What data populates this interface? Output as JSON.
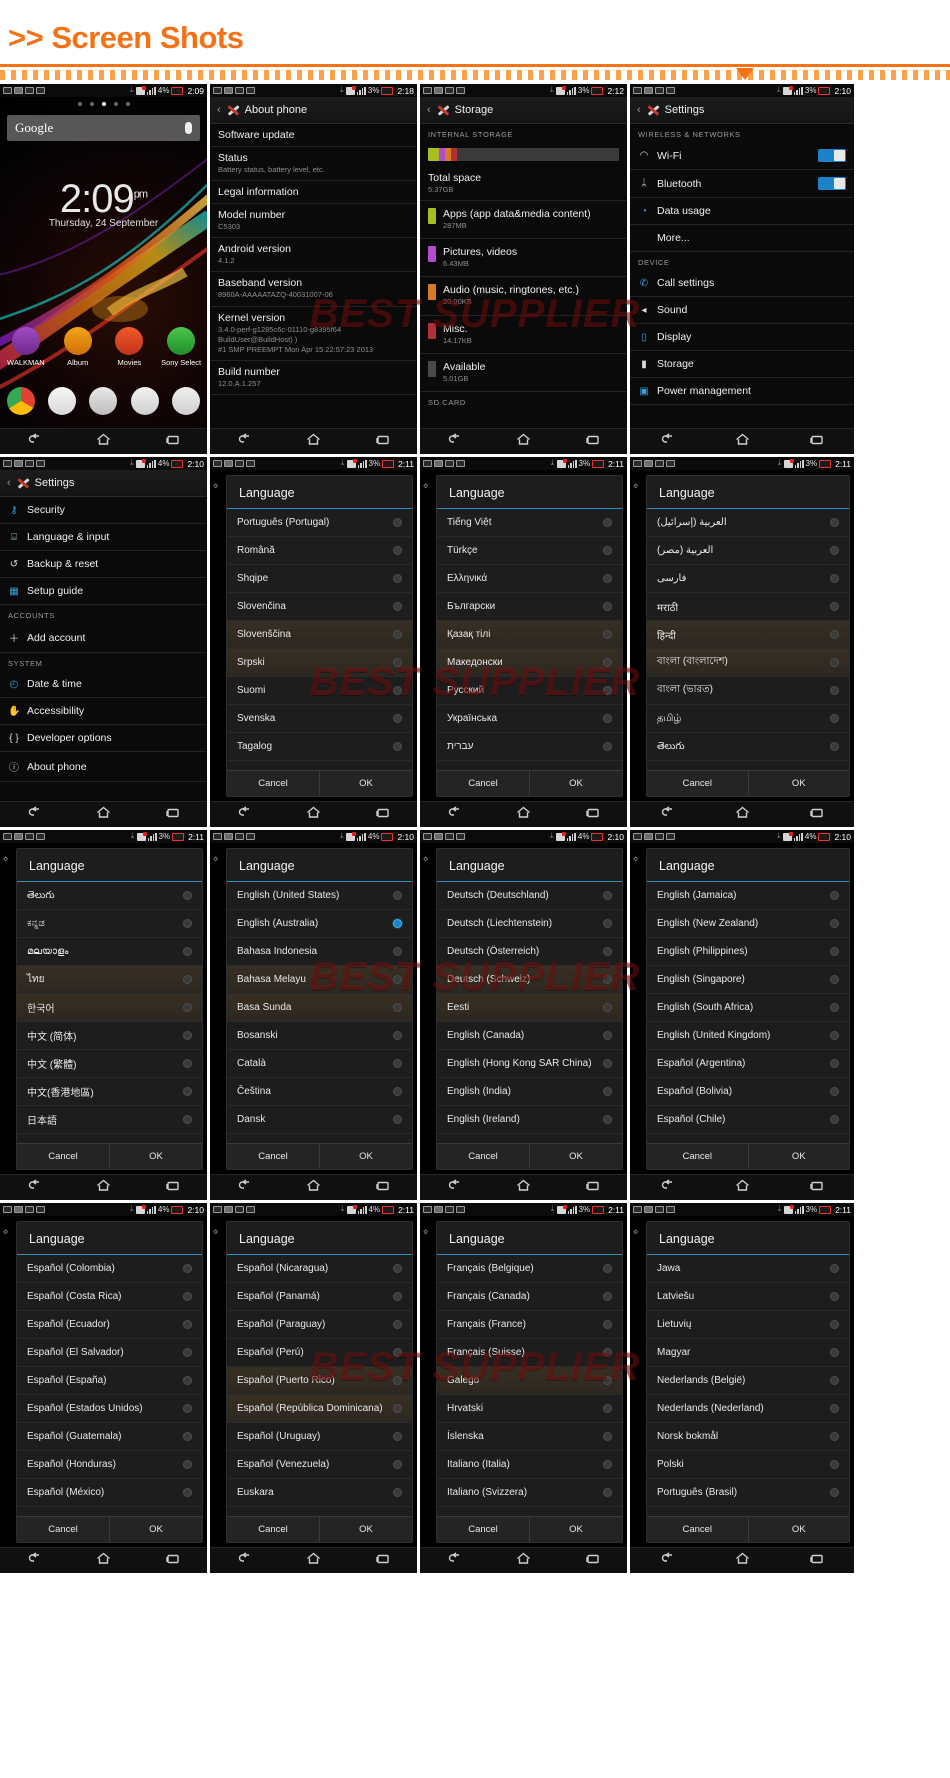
{
  "header": {
    "title": ">> Screen Shots"
  },
  "watermark": {
    "text": "BEST SUPPLIER"
  },
  "common": {
    "cancel": "Cancel",
    "ok": "OK",
    "language_title": "Language",
    "nav": {
      "back": "back-icon",
      "home": "home-icon",
      "recents": "recents-icon"
    }
  },
  "shots": [
    {
      "id": "home-screen",
      "status": {
        "battery": "4%",
        "time": "2:09"
      },
      "type": "home",
      "search_placeholder": "Google",
      "clock": {
        "time": "2:09",
        "meridiem": "pm",
        "date": "Thursday, 24 September"
      },
      "apps": [
        "WALKMAN",
        "Album",
        "Movies",
        "Sony Select"
      ]
    },
    {
      "id": "about-phone",
      "status": {
        "battery": "3%",
        "time": "2:18"
      },
      "type": "about",
      "title": "About phone",
      "items": [
        {
          "label": "Software update",
          "value": ""
        },
        {
          "label": "Status",
          "value": "Battery status, battery level, etc."
        },
        {
          "label": "Legal information",
          "value": ""
        },
        {
          "label": "Model number",
          "value": "C5303"
        },
        {
          "label": "Android version",
          "value": "4.1.2"
        },
        {
          "label": "Baseband version",
          "value": "8960A-AAAAATAZQ-40031007-06"
        },
        {
          "label": "Kernel version",
          "value": "3.4.0-perf-g1285c6c-01110-g8395f64\nBuildUser@BuildHost) )\n#1 SMP PREEMPT Mon Apr 15 22:57:23 2013"
        },
        {
          "label": "Build number",
          "value": "12.0.A.1.257"
        }
      ]
    },
    {
      "id": "storage",
      "status": {
        "battery": "3%",
        "time": "2:12"
      },
      "type": "storage",
      "title": "Storage",
      "section_internal": "INTERNAL STORAGE",
      "section_sd": "SD CARD",
      "total_label": "Total space",
      "total_value": "5.37GB",
      "entries": [
        {
          "label": "Apps (app data&media content)",
          "value": "287MB",
          "color": "#a8bf21"
        },
        {
          "label": "Pictures, videos",
          "value": "6.43MB",
          "color": "#b14bd0"
        },
        {
          "label": "Audio (music, ringtones, etc.)",
          "value": "20.00KB",
          "color": "#d97b22"
        },
        {
          "label": "Misc.",
          "value": "14.17KB",
          "color": "#b03038"
        },
        {
          "label": "Available",
          "value": "5.01GB",
          "color": "#4a4a4a"
        }
      ]
    },
    {
      "id": "settings-top",
      "status": {
        "battery": "3%",
        "time": "2:10"
      },
      "type": "settings",
      "title": "Settings",
      "groups": [
        {
          "header": "WIRELESS & NETWORKS",
          "items": [
            {
              "label": "Wi-Fi",
              "icon": "wifi-icon",
              "toggle": true
            },
            {
              "label": "Bluetooth",
              "icon": "bluetooth-icon",
              "toggle": true
            },
            {
              "label": "Data usage",
              "icon": "data-usage-icon",
              "toggle": false
            },
            {
              "label": "More...",
              "icon": "",
              "toggle": false
            }
          ]
        },
        {
          "header": "DEVICE",
          "items": [
            {
              "label": "Call settings",
              "icon": "phone-icon",
              "toggle": false
            },
            {
              "label": "Sound",
              "icon": "sound-icon",
              "toggle": false
            },
            {
              "label": "Display",
              "icon": "display-icon",
              "toggle": false
            },
            {
              "label": "Storage",
              "icon": "storage-icon",
              "toggle": false
            },
            {
              "label": "Power management",
              "icon": "power-icon",
              "toggle": false
            }
          ]
        }
      ]
    },
    {
      "id": "settings-bottom",
      "status": {
        "battery": "4%",
        "time": "2:10"
      },
      "type": "settings",
      "title": "Settings",
      "groups": [
        {
          "header": "",
          "items": [
            {
              "label": "Security",
              "icon": "key-icon",
              "toggle": false
            },
            {
              "label": "Language & input",
              "icon": "keyboard-icon",
              "toggle": false
            },
            {
              "label": "Backup & reset",
              "icon": "restore-icon",
              "toggle": false
            },
            {
              "label": "Setup guide",
              "icon": "guide-icon",
              "toggle": false
            }
          ]
        },
        {
          "header": "ACCOUNTS",
          "items": [
            {
              "label": "Add account",
              "icon": "plus-icon",
              "toggle": false
            }
          ]
        },
        {
          "header": "SYSTEM",
          "items": [
            {
              "label": "Date & time",
              "icon": "clock-icon",
              "toggle": false
            },
            {
              "label": "Accessibility",
              "icon": "hand-icon",
              "toggle": false
            },
            {
              "label": "Developer options",
              "icon": "braces-icon",
              "toggle": false
            },
            {
              "label": "About phone",
              "icon": "info-icon",
              "toggle": false
            }
          ]
        }
      ]
    },
    {
      "id": "language-eu-1",
      "status": {
        "battery": "3%",
        "time": "2:11"
      },
      "type": "language",
      "languages": [
        {
          "label": "Português (Portugal)",
          "selected": false,
          "highlight": false
        },
        {
          "label": "Română",
          "selected": false,
          "highlight": false
        },
        {
          "label": "Shqipe",
          "selected": false,
          "highlight": false
        },
        {
          "label": "Slovenčina",
          "selected": false,
          "highlight": false
        },
        {
          "label": "Slovenščina",
          "selected": false,
          "highlight": true
        },
        {
          "label": "Srpski",
          "selected": false,
          "highlight": true
        },
        {
          "label": "Suomi",
          "selected": false,
          "highlight": false
        },
        {
          "label": "Svenska",
          "selected": false,
          "highlight": false
        },
        {
          "label": "Tagalog",
          "selected": false,
          "highlight": false
        }
      ]
    },
    {
      "id": "language-cyrillic",
      "status": {
        "battery": "3%",
        "time": "2:11"
      },
      "type": "language",
      "languages": [
        {
          "label": "Tiếng Việt",
          "selected": false,
          "highlight": false
        },
        {
          "label": "Türkçe",
          "selected": false,
          "highlight": false
        },
        {
          "label": "Ελληνικά",
          "selected": false,
          "highlight": false
        },
        {
          "label": "Български",
          "selected": false,
          "highlight": false
        },
        {
          "label": "Қазақ тілі",
          "selected": false,
          "highlight": true
        },
        {
          "label": "Македонски",
          "selected": false,
          "highlight": true
        },
        {
          "label": "Русский",
          "selected": false,
          "highlight": false
        },
        {
          "label": "Українська",
          "selected": false,
          "highlight": false
        },
        {
          "label": "עברית",
          "selected": false,
          "highlight": false
        }
      ]
    },
    {
      "id": "language-arabic-indic",
      "status": {
        "battery": "3%",
        "time": "2:11"
      },
      "type": "language",
      "languages": [
        {
          "label": "العربية (إسرائيل)",
          "selected": false,
          "highlight": false
        },
        {
          "label": "العربية (مصر)",
          "selected": false,
          "highlight": false
        },
        {
          "label": "فارسی",
          "selected": false,
          "highlight": false
        },
        {
          "label": "मराठी",
          "selected": false,
          "highlight": false
        },
        {
          "label": "हिन्दी",
          "selected": false,
          "highlight": true
        },
        {
          "label": "বাংলা (বাংলাদেশ)",
          "selected": false,
          "highlight": true
        },
        {
          "label": "বাংলা (ভারত)",
          "selected": false,
          "highlight": false
        },
        {
          "label": "தமிழ்",
          "selected": false,
          "highlight": false
        },
        {
          "label": "తెలుగు",
          "selected": false,
          "highlight": false
        }
      ]
    },
    {
      "id": "language-asian",
      "status": {
        "battery": "3%",
        "time": "2:11"
      },
      "type": "language",
      "languages": [
        {
          "label": "తెలుగు",
          "selected": false,
          "highlight": false
        },
        {
          "label": "ಕನ್ನಡ",
          "selected": false,
          "highlight": false
        },
        {
          "label": "മലയാളം",
          "selected": false,
          "highlight": false
        },
        {
          "label": "ไทย",
          "selected": false,
          "highlight": true
        },
        {
          "label": "한국어",
          "selected": false,
          "highlight": true
        },
        {
          "label": "中文 (简体)",
          "selected": false,
          "highlight": false
        },
        {
          "label": "中文 (繁體)",
          "selected": false,
          "highlight": false
        },
        {
          "label": "中文(香港地區)",
          "selected": false,
          "highlight": false
        },
        {
          "label": "日本語",
          "selected": false,
          "highlight": false
        }
      ]
    },
    {
      "id": "language-english-asia",
      "status": {
        "battery": "4%",
        "time": "2:10"
      },
      "type": "language",
      "languages": [
        {
          "label": "English (United States)",
          "selected": false,
          "highlight": false
        },
        {
          "label": "English (Australia)",
          "selected": true,
          "highlight": false
        },
        {
          "label": "Bahasa Indonesia",
          "selected": false,
          "highlight": false
        },
        {
          "label": "Bahasa Melayu",
          "selected": false,
          "highlight": true
        },
        {
          "label": "Basa Sunda",
          "selected": false,
          "highlight": true
        },
        {
          "label": "Bosanski",
          "selected": false,
          "highlight": false
        },
        {
          "label": "Català",
          "selected": false,
          "highlight": false
        },
        {
          "label": "Čeština",
          "selected": false,
          "highlight": false
        },
        {
          "label": "Dansk",
          "selected": false,
          "highlight": false
        }
      ]
    },
    {
      "id": "language-german",
      "status": {
        "battery": "4%",
        "time": "2:10"
      },
      "type": "language",
      "languages": [
        {
          "label": "Deutsch (Deutschland)",
          "selected": false,
          "highlight": false
        },
        {
          "label": "Deutsch (Liechtenstein)",
          "selected": false,
          "highlight": false
        },
        {
          "label": "Deutsch (Österreich)",
          "selected": false,
          "highlight": false
        },
        {
          "label": "Deutsch (Schweiz)",
          "selected": false,
          "highlight": true
        },
        {
          "label": "Eesti",
          "selected": false,
          "highlight": true
        },
        {
          "label": "English (Canada)",
          "selected": false,
          "highlight": false
        },
        {
          "label": "English (Hong Kong SAR China)",
          "selected": false,
          "highlight": false
        },
        {
          "label": "English (India)",
          "selected": false,
          "highlight": false
        },
        {
          "label": "English (Ireland)",
          "selected": false,
          "highlight": false
        }
      ]
    },
    {
      "id": "language-english-world",
      "status": {
        "battery": "4%",
        "time": "2:10"
      },
      "type": "language",
      "languages": [
        {
          "label": "English (Jamaica)",
          "selected": false,
          "highlight": false
        },
        {
          "label": "English (New Zealand)",
          "selected": false,
          "highlight": false
        },
        {
          "label": "English (Philippines)",
          "selected": false,
          "highlight": false
        },
        {
          "label": "English (Singapore)",
          "selected": false,
          "highlight": false
        },
        {
          "label": "English (South Africa)",
          "selected": false,
          "highlight": false
        },
        {
          "label": "English (United Kingdom)",
          "selected": false,
          "highlight": false
        },
        {
          "label": "Español (Argentina)",
          "selected": false,
          "highlight": false
        },
        {
          "label": "Español (Bolivia)",
          "selected": false,
          "highlight": false
        },
        {
          "label": "Español (Chile)",
          "selected": false,
          "highlight": false
        }
      ]
    },
    {
      "id": "language-spanish-1",
      "status": {
        "battery": "4%",
        "time": "2:10"
      },
      "type": "language",
      "languages": [
        {
          "label": "Español (Colombia)",
          "selected": false,
          "highlight": false
        },
        {
          "label": "Español (Costa Rica)",
          "selected": false,
          "highlight": false
        },
        {
          "label": "Español (Ecuador)",
          "selected": false,
          "highlight": false
        },
        {
          "label": "Español (El Salvador)",
          "selected": false,
          "highlight": false
        },
        {
          "label": "Español (España)",
          "selected": false,
          "highlight": false
        },
        {
          "label": "Español (Estados Unidos)",
          "selected": false,
          "highlight": false
        },
        {
          "label": "Español (Guatemala)",
          "selected": false,
          "highlight": false
        },
        {
          "label": "Español (Honduras)",
          "selected": false,
          "highlight": false
        },
        {
          "label": "Español (México)",
          "selected": false,
          "highlight": false
        }
      ]
    },
    {
      "id": "language-spanish-2",
      "status": {
        "battery": "4%",
        "time": "2:11"
      },
      "type": "language",
      "languages": [
        {
          "label": "Español (Nicaragua)",
          "selected": false,
          "highlight": false
        },
        {
          "label": "Español (Panamá)",
          "selected": false,
          "highlight": false
        },
        {
          "label": "Español (Paraguay)",
          "selected": false,
          "highlight": false
        },
        {
          "label": "Español (Perú)",
          "selected": false,
          "highlight": false
        },
        {
          "label": "Español (Puerto Rico)",
          "selected": false,
          "highlight": true
        },
        {
          "label": "Español (República Dominicana)",
          "selected": false,
          "highlight": true
        },
        {
          "label": "Español (Uruguay)",
          "selected": false,
          "highlight": false
        },
        {
          "label": "Español (Venezuela)",
          "selected": false,
          "highlight": false
        },
        {
          "label": "Euskara",
          "selected": false,
          "highlight": false
        }
      ]
    },
    {
      "id": "language-french",
      "status": {
        "battery": "3%",
        "time": "2:11"
      },
      "type": "language",
      "languages": [
        {
          "label": "Français (Belgique)",
          "selected": false,
          "highlight": false
        },
        {
          "label": "Français (Canada)",
          "selected": false,
          "highlight": false
        },
        {
          "label": "Français (France)",
          "selected": false,
          "highlight": false
        },
        {
          "label": "Français (Suisse)",
          "selected": false,
          "highlight": false
        },
        {
          "label": "Galego",
          "selected": false,
          "highlight": true
        },
        {
          "label": "Hrvatski",
          "selected": false,
          "highlight": false
        },
        {
          "label": "Íslenska",
          "selected": false,
          "highlight": false
        },
        {
          "label": "Italiano (Italia)",
          "selected": false,
          "highlight": false
        },
        {
          "label": "Italiano (Svizzera)",
          "selected": false,
          "highlight": false
        }
      ]
    },
    {
      "id": "language-misc",
      "status": {
        "battery": "3%",
        "time": "2:11"
      },
      "type": "language",
      "languages": [
        {
          "label": "Jawa",
          "selected": false,
          "highlight": false
        },
        {
          "label": "Latviešu",
          "selected": false,
          "highlight": false
        },
        {
          "label": "Lietuvių",
          "selected": false,
          "highlight": false
        },
        {
          "label": "Magyar",
          "selected": false,
          "highlight": false
        },
        {
          "label": "Nederlands (België)",
          "selected": false,
          "highlight": false
        },
        {
          "label": "Nederlands (Nederland)",
          "selected": false,
          "highlight": false
        },
        {
          "label": "Norsk bokmål",
          "selected": false,
          "highlight": false
        },
        {
          "label": "Polski",
          "selected": false,
          "highlight": false
        },
        {
          "label": "Português (Brasil)",
          "selected": false,
          "highlight": false
        }
      ]
    }
  ]
}
